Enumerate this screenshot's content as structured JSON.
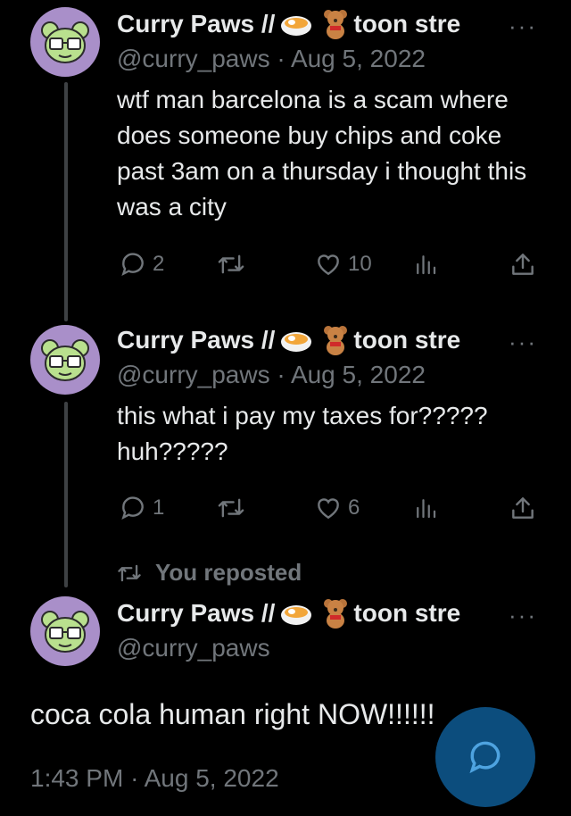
{
  "tweets": [
    {
      "author_name": "Curry Paws //",
      "author_name_tail": "toon stre",
      "handle": "@curry_paws",
      "separator": "·",
      "date": "Aug 5, 2022",
      "text": "wtf man barcelona is a scam where does someone buy chips and coke past 3am on a thursday i thought this was a city",
      "replies": "2",
      "likes": "10"
    },
    {
      "author_name": "Curry Paws //",
      "author_name_tail": "toon stre",
      "handle": "@curry_paws",
      "separator": "·",
      "date": "Aug 5, 2022",
      "text": "this what i pay my taxes for????? huh?????",
      "replies": "1",
      "likes": "6"
    }
  ],
  "repost_label": "You reposted",
  "main_tweet": {
    "author_name": "Curry Paws //",
    "author_name_tail": "toon stre",
    "handle": "@curry_paws",
    "text": "coca cola human right NOW!!!!!!",
    "time": "1:43 PM",
    "separator": "·",
    "date": "Aug 5, 2022"
  },
  "more_label": "···",
  "colors": {
    "background": "#000000",
    "text": "#e7e9ea",
    "muted": "#71767b",
    "avatar": "#a98fc9",
    "fab": "#0c4d7d"
  },
  "icons": [
    "reply-icon",
    "retweet-icon",
    "like-icon",
    "views-icon",
    "share-icon",
    "compose-reply-icon",
    "curry-emoji-icon",
    "bear-emoji-icon"
  ]
}
